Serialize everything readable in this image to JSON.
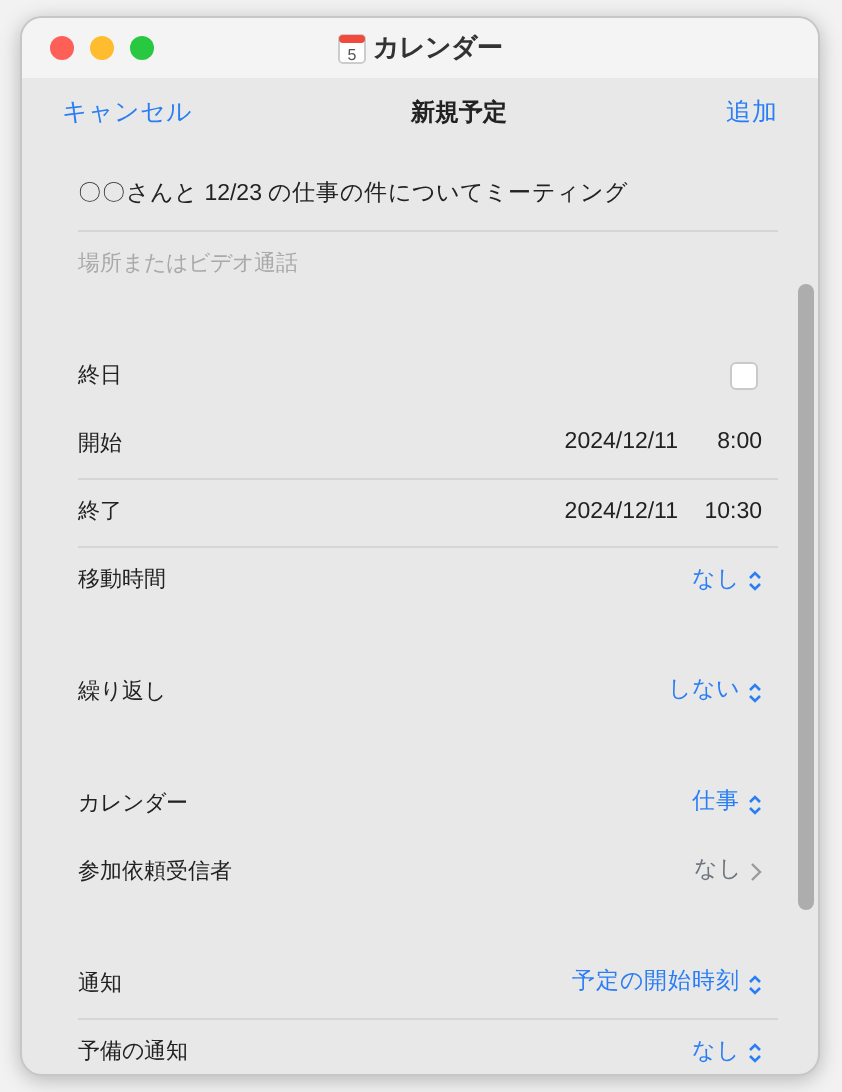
{
  "window": {
    "title": "カレンダー",
    "icon_day": "5"
  },
  "toolbar": {
    "cancel": "キャンセル",
    "title": "新規予定",
    "add": "追加"
  },
  "event": {
    "title": "〇〇さんと 12/23 の仕事の件についてミーティング",
    "location_placeholder": "場所またはビデオ通話"
  },
  "sections": [
    {
      "rows": [
        {
          "kind": "checkbox",
          "label": "終日",
          "checked": false,
          "divider": false
        },
        {
          "kind": "datetime",
          "label": "開始",
          "date": "2024/12/11",
          "time": "8:00",
          "divider": false
        },
        {
          "kind": "datetime",
          "label": "終了",
          "date": "2024/12/11",
          "time": "10:30",
          "divider": true
        },
        {
          "kind": "popup",
          "label": "移動時間",
          "value": "なし",
          "divider": true
        }
      ]
    },
    {
      "rows": [
        {
          "kind": "popup",
          "label": "繰り返し",
          "value": "しない",
          "divider": false
        }
      ]
    },
    {
      "rows": [
        {
          "kind": "popup",
          "label": "カレンダー",
          "value": "仕事",
          "divider": false
        },
        {
          "kind": "link",
          "label": "参加依頼受信者",
          "value": "なし",
          "divider": false
        }
      ]
    },
    {
      "rows": [
        {
          "kind": "popup",
          "label": "通知",
          "value": "予定の開始時刻",
          "divider": false
        },
        {
          "kind": "popup",
          "label": "予備の通知",
          "value": "なし",
          "divider": true
        }
      ]
    }
  ]
}
